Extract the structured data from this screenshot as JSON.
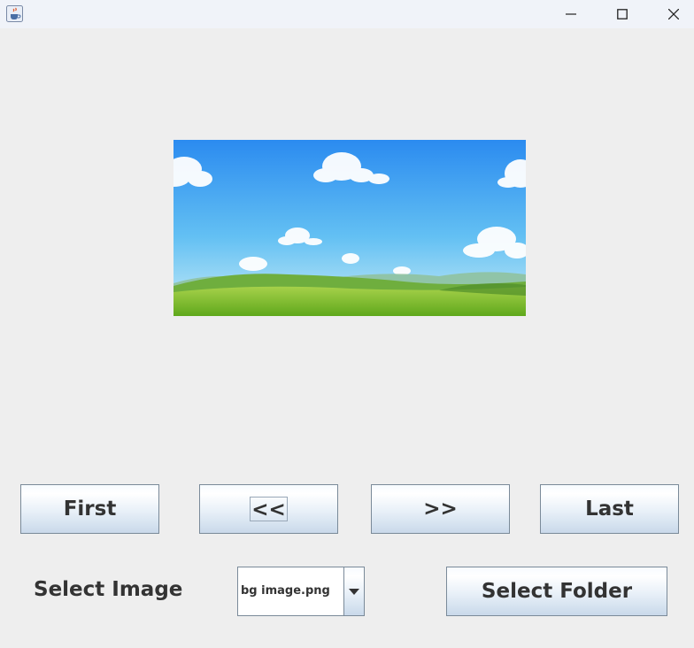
{
  "window": {
    "app_icon": "java-coffee-cup-icon",
    "controls": [
      "minimize-icon",
      "maximize-icon",
      "close-icon"
    ]
  },
  "preview": {
    "image": "landscape-sky-clouds-hills",
    "colors": {
      "sky_top": "#2f8ff0",
      "sky_bottom": "#bfe6f6",
      "grass": "#7dbb2c"
    }
  },
  "nav": {
    "first_label": "First",
    "prev_label": "<<",
    "next_label": ">>",
    "last_label": "Last"
  },
  "bottom": {
    "select_image_label": "Select Image",
    "combo_value": "bg image.png",
    "select_folder_label": "Select Folder"
  }
}
